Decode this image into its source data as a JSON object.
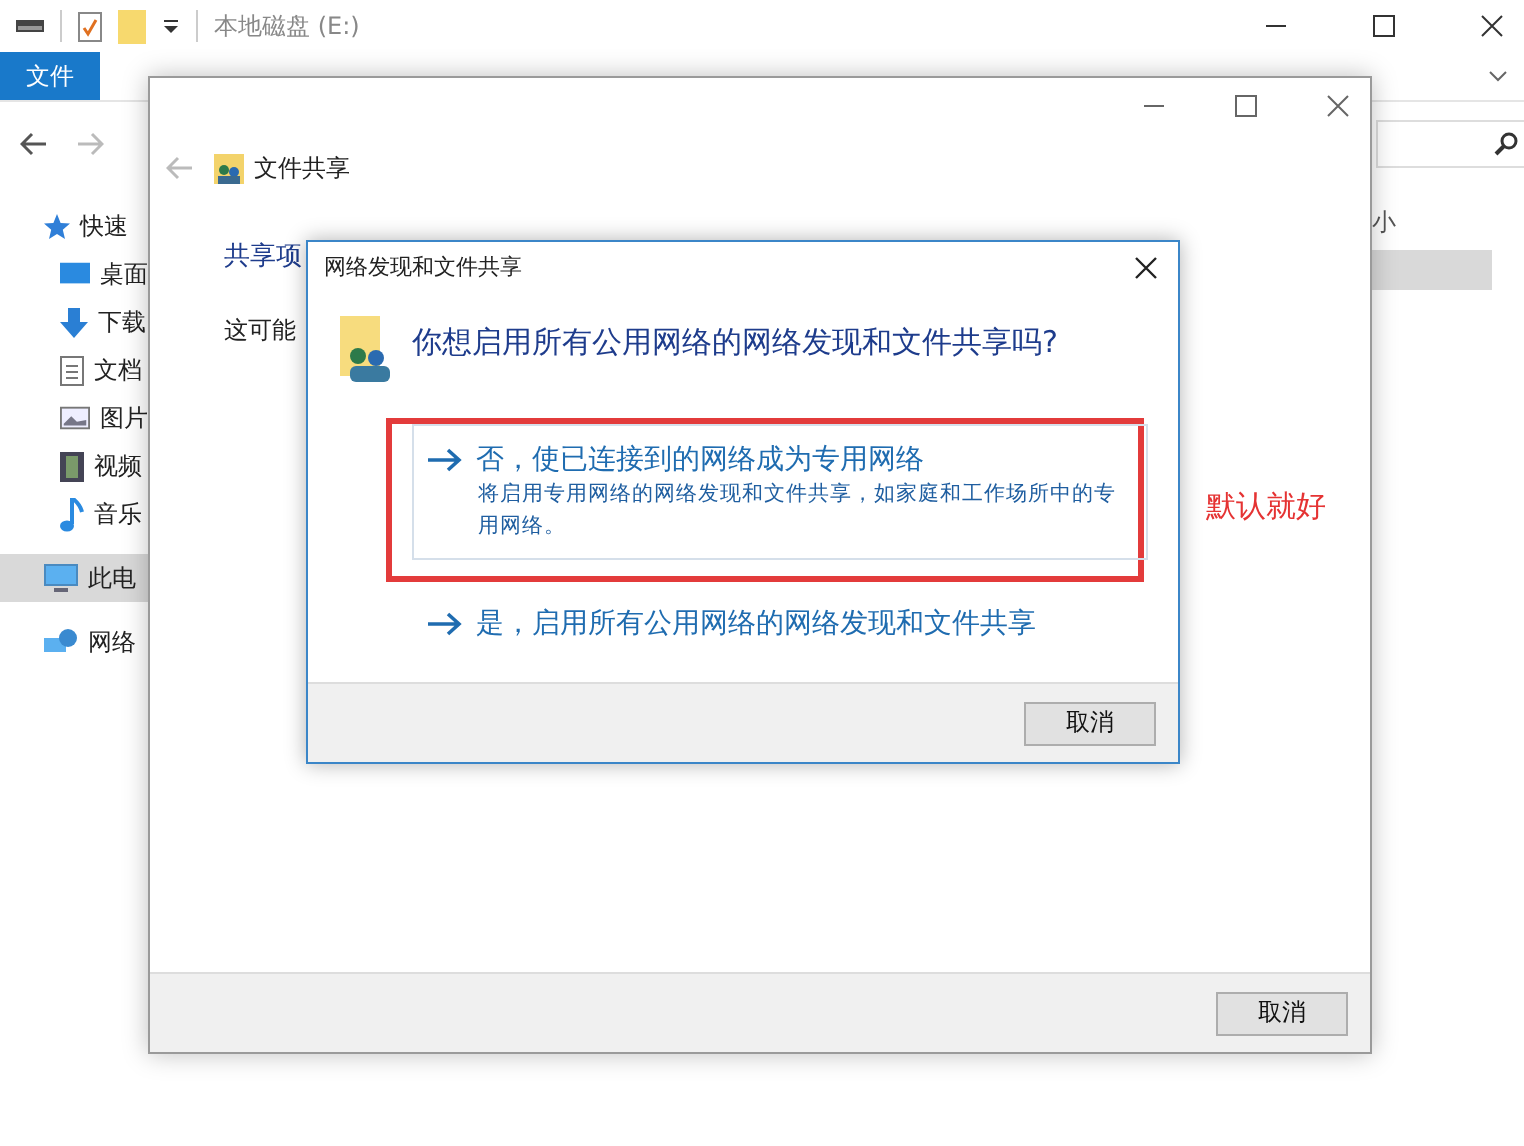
{
  "explorer": {
    "title": "本地磁盘 (E:)",
    "ribbon_tabs": [
      {
        "label": "文件",
        "selected": true
      }
    ],
    "nav": [
      {
        "label": "快速",
        "selected": false,
        "children": [
          {
            "label": "桌面",
            "selected": false
          },
          {
            "label": "下载",
            "selected": false
          },
          {
            "label": "文档",
            "selected": false
          },
          {
            "label": "图片",
            "selected": false
          },
          {
            "label": "视频",
            "selected": false
          },
          {
            "label": "音乐",
            "selected": false
          }
        ]
      },
      {
        "label": "此电",
        "selected": true
      },
      {
        "label": "网络",
        "selected": false
      }
    ],
    "column_header": "小"
  },
  "share_window": {
    "title": "文件共享",
    "heading": "共享项",
    "text": "这可能",
    "buttons": [
      "取消"
    ]
  },
  "dialog": {
    "title": "网络发现和文件共享",
    "question": "你想启用所有公用网络的网络发现和文件共享吗?",
    "options": [
      {
        "title": "否，使已连接到的网络成为专用网络",
        "description": "将启用专用网络的网络发现和文件共享，如家庭和工作场所中的专用网络。",
        "highlighted": true,
        "marked": true
      },
      {
        "title": "是，启用所有公用网络的网络发现和文件共享",
        "highlighted": false,
        "marked": false
      }
    ],
    "buttons": [
      "取消"
    ]
  },
  "annotation": {
    "text": "默认就好"
  }
}
